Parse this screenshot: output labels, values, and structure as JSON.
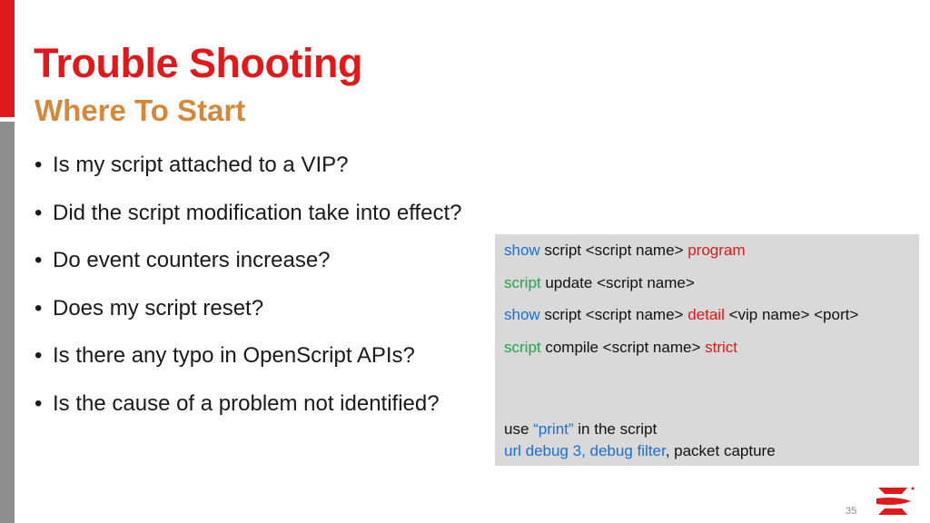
{
  "slide": {
    "title": "Trouble Shooting",
    "subtitle": "Where To Start",
    "bullet_char": "•",
    "bullets": [
      "Is my script attached to a VIP?",
      "Did the script modification take into effect?",
      "Do event counters increase?",
      "Does my script reset?",
      "Is there any typo in OpenScript APIs?",
      "Is the cause of a problem not identified?"
    ],
    "page_number": "35"
  },
  "commands": {
    "line1": {
      "kw": "show",
      "text": " script <script name> ",
      "opt": "program"
    },
    "line2": {
      "kw": "script",
      "text": " update <script name>"
    },
    "line3": {
      "kw": "show",
      "text": " script <script name> ",
      "opt": "detail",
      "tail": " <vip name> <port>"
    },
    "line4": {
      "kw": "script",
      "text": " compile <script name> ",
      "opt": "strict"
    },
    "line5": {
      "pre": "use ",
      "kw": "“print”",
      "post": " in the script"
    },
    "line6": {
      "kw": "url debug 3, debug filter",
      "post": ", packet capture"
    }
  },
  "colors": {
    "accent_red": "#e01a1a",
    "subtitle_orange": "#d4893a",
    "keyword_blue": "#1d6fd1",
    "keyword_green": "#1ea64a",
    "box_gray": "#d9d9d9"
  },
  "icons": {
    "logo": "brocade-b-logo-icon"
  }
}
